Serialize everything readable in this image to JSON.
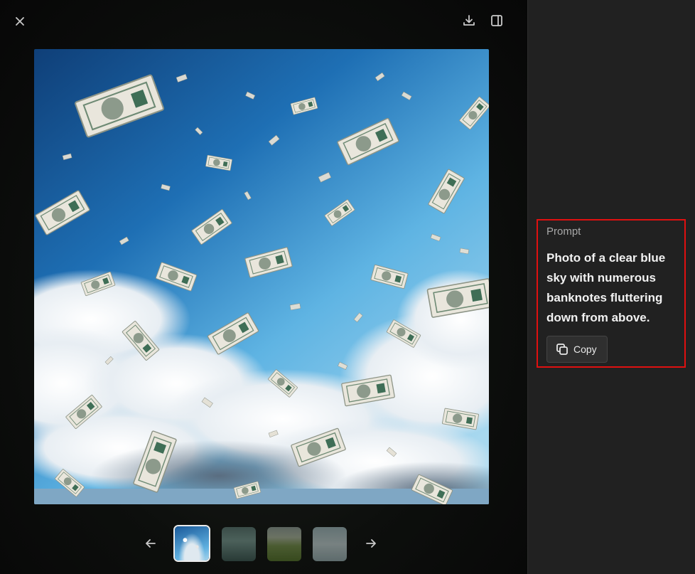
{
  "toolbar": {
    "close_icon": "close-icon",
    "download_icon": "download-icon",
    "sidebar_toggle_icon": "sidebar-toggle-icon"
  },
  "image": {
    "main_icon": "generated-image"
  },
  "carousel": {
    "prev_icon": "arrow-left-icon",
    "next_icon": "arrow-right-icon",
    "selected_index": 1,
    "count": 4
  },
  "prompt": {
    "label": "Prompt",
    "text": "Photo of a clear blue sky with numerous banknotes fluttering down from above.",
    "copy_label": "Copy",
    "copy_icon": "copy-icon"
  },
  "colors": {
    "highlight": "#e01010",
    "sidebar_bg": "#212121",
    "sky_blue": "#2a7fc4"
  }
}
